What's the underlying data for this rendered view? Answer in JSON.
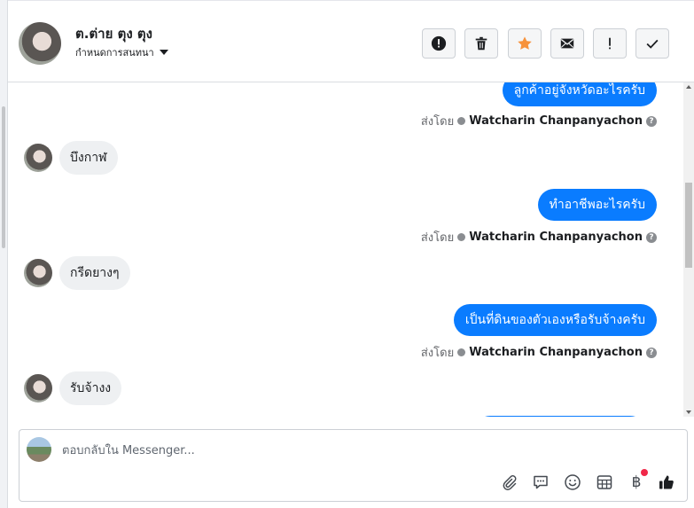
{
  "header": {
    "name": "ต.ต่าย ตุง ตุง",
    "sub_label": "กำหนดการสนทนา"
  },
  "messages": {
    "out_1": "ลูกค้าอยู่จังหวัดอะไรครับ",
    "in_1": "บึงกาฬ",
    "out_2": "ทำอาชีพอะไรครับ",
    "in_2": "กรีดยางๆ",
    "out_3": "เป็นที่ดินของตัวเองหรือรับจ้างครับ",
    "in_3": "รับจ้างง"
  },
  "sender": {
    "prefix": "ส่งโดย",
    "name": "Watcharin Chanpanyachon"
  },
  "composer": {
    "placeholder": "ตอบกลับใน Messenger..."
  },
  "icons": {
    "header_buttons": [
      "alert-circle-icon",
      "trash-icon",
      "star-icon",
      "envelope-icon",
      "exclamation-icon",
      "check-icon"
    ],
    "toolbar": [
      "paperclip-icon",
      "speech-bubble-icon",
      "smiley-icon",
      "table-icon",
      "baht-icon",
      "thumbs-up-icon"
    ],
    "baht_symbol": "฿"
  },
  "colors": {
    "outgoing_bubble": "#0a7cff",
    "incoming_bubble": "#eef0f2",
    "star": "#f7923b",
    "notification_dot": "#f02849"
  }
}
